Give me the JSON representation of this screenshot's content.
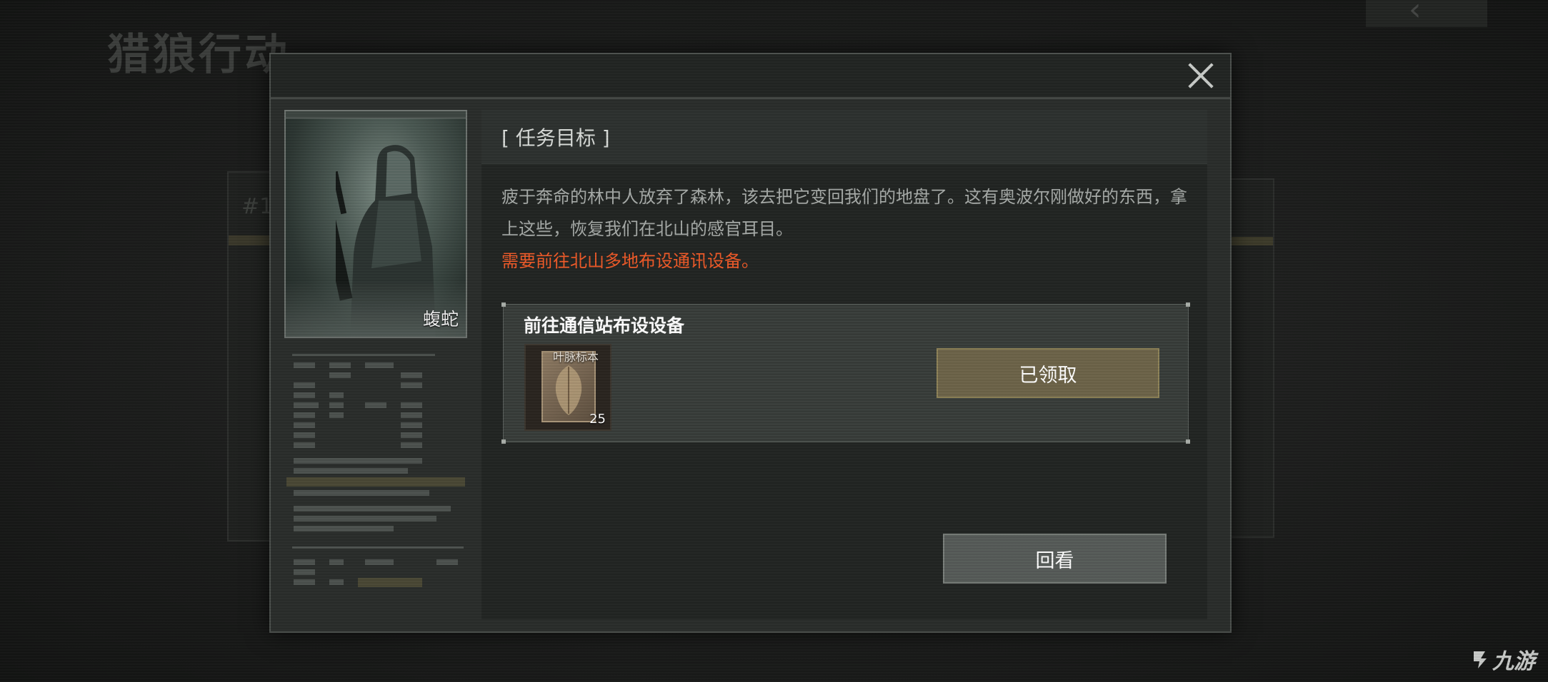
{
  "background": {
    "title": "猎狼行动",
    "left_panel_number": "#1"
  },
  "dialog": {
    "close_icon": "close-icon",
    "portrait": {
      "character_name": "蝮蛇"
    },
    "section_title": "[ 任务目标 ]",
    "description": "疲于奔命的林中人放弃了森林，该去把它变回我们的地盘了。这有奥波尔刚做好的东西，拿上这些，恢复我们在北山的感官耳目。",
    "description_warning": "需要前往北山多地布设通讯设备。",
    "task": {
      "title": "前往通信站布设设备",
      "reward": {
        "name": "叶脉标本",
        "count": "25"
      },
      "claimed_label": "已领取"
    },
    "review_label": "回看"
  },
  "watermark": {
    "text": "九游"
  },
  "colors": {
    "warning": "#f05a28",
    "claimed_button": "#6d6449",
    "review_button": "#565b58"
  }
}
